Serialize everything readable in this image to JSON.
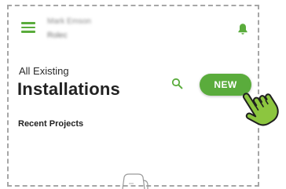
{
  "header": {
    "user_name": "Mark Emson",
    "company": "Rolec"
  },
  "page": {
    "subtitle": "All Existing",
    "title": "Installations"
  },
  "actions": {
    "new_label": "NEW"
  },
  "sections": {
    "recent_title": "Recent Projects"
  },
  "icons": {
    "menu": "hamburger-menu-icon",
    "notifications": "bell-icon",
    "search": "search-icon",
    "pointer": "hand-pointer-icon"
  },
  "colors": {
    "accent": "#5aac3c",
    "button": "#5aac3c",
    "pointer_fill": "#8cc63f",
    "text": "#222222"
  }
}
